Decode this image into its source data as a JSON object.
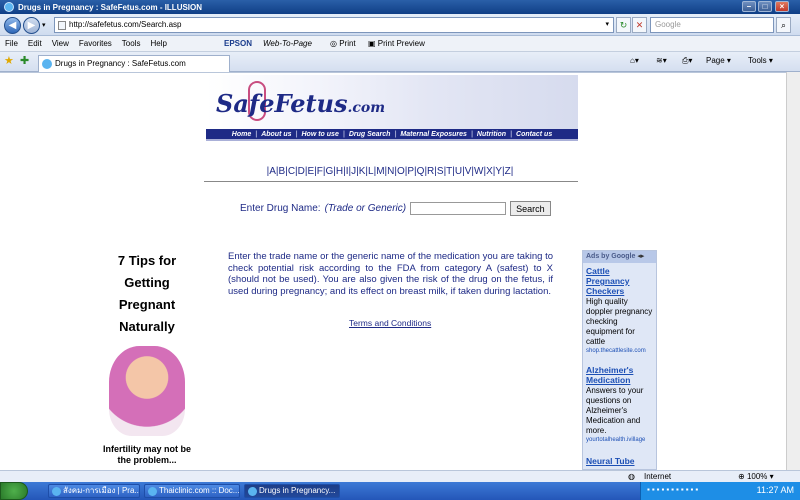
{
  "window": {
    "title": "Drugs in Pregnancy : SafeFetus.com - ILLUSION"
  },
  "address": {
    "url": "http://safefetus.com/Search.asp",
    "search_placeholder": "Google"
  },
  "menu": [
    "File",
    "Edit",
    "View",
    "Favorites",
    "Tools",
    "Help"
  ],
  "epson_toolbar": {
    "brand": "EPSON",
    "web_to_page": "Web-To-Page",
    "print": "Print",
    "print_preview": "Print Preview"
  },
  "tab": {
    "title": "Drugs in Pregnancy : SafeFetus.com"
  },
  "command_bar": {
    "page": "Page",
    "tools": "Tools"
  },
  "site": {
    "logo_text": "SafeFetus",
    "logo_suffix": ".com",
    "nav": [
      "Home",
      "About us",
      "How to use",
      "Drug Search",
      "Maternal Exposures",
      "Nutrition",
      "Contact us"
    ],
    "alphabet": [
      "A",
      "B",
      "C",
      "D",
      "E",
      "F",
      "G",
      "H",
      "I",
      "J",
      "K",
      "L",
      "M",
      "N",
      "O",
      "P",
      "Q",
      "R",
      "S",
      "T",
      "U",
      "V",
      "W",
      "X",
      "Y",
      "Z"
    ],
    "drug_label": "Enter Drug Name:",
    "drug_hint": "(Trade  or Generic)",
    "search_button": "Search",
    "description": "Enter the trade name or the generic name of the medication you are taking to check potential risk according to the FDA from category A (safest) to X (should not be used). You are also given the risk of the drug on the fetus, if used during pregnancy; and its effect on breast milk, if taken during lactation.",
    "terms": "Terms and Conditions"
  },
  "left_ad": {
    "lines": [
      "7 Tips for",
      "Getting",
      "Pregnant",
      "Naturally"
    ],
    "note": "Infertility may not be the problem..."
  },
  "google_ads": {
    "header": "Ads by Google",
    "ads": [
      {
        "title": "Cattle Pregnancy Checkers",
        "body": "High quality doppler pregnancy checking equipment for cattle",
        "url": "shop.thecattlesite.com"
      },
      {
        "title": "Alzheimer's Medication",
        "body": "Answers to your questions on Alzheimer's Medication and more.",
        "url": "yourtotalhealth.ivillage"
      },
      {
        "title": "Neural Tube",
        "body": "",
        "url": ""
      }
    ]
  },
  "status": {
    "zone": "Internet",
    "zoom": "100%"
  },
  "taskbar": {
    "buttons": [
      "สังคม-การเมือง | Pra...",
      "Thaiclinic.com :: Doc...",
      "Drugs in Pregnancy..."
    ],
    "clock": "11:27 AM"
  }
}
